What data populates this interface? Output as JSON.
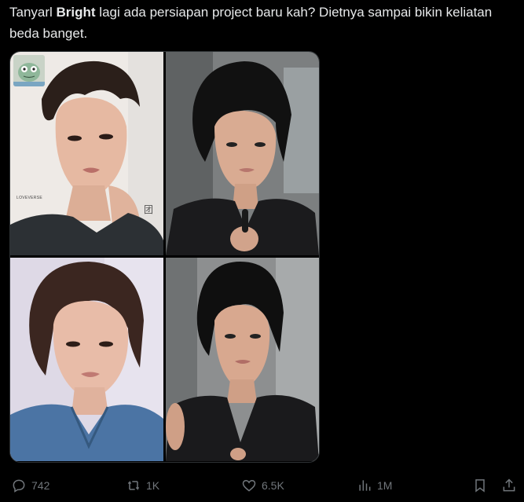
{
  "post": {
    "text_before": "Tanyarl ",
    "text_bold": "Bright",
    "text_after": " lagi ada persiapan project baru kah? Dietnya sampai bikin keliatan beda banget."
  },
  "media": {
    "photos": [
      {
        "name": "photo-top-left",
        "watermark": "LOVEVERSE"
      },
      {
        "name": "photo-top-right"
      },
      {
        "name": "photo-bottom-left"
      },
      {
        "name": "photo-bottom-right"
      }
    ]
  },
  "actions": {
    "reply_count": "742",
    "repost_count": "1K",
    "like_count": "6.5K",
    "view_count": "1M"
  },
  "icons": {
    "reply": "reply-icon",
    "repost": "repost-icon",
    "like": "heart-icon",
    "views": "views-icon",
    "bookmark": "bookmark-icon",
    "share": "share-icon"
  }
}
